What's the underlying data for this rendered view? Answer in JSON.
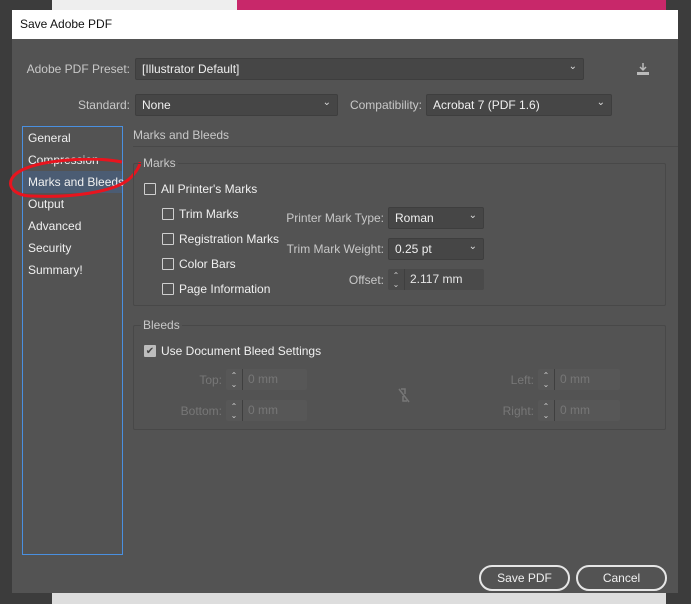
{
  "window": {
    "title": "Save Adobe PDF"
  },
  "preset": {
    "label": "Adobe PDF Preset:",
    "value": "[Illustrator Default]"
  },
  "standard": {
    "label": "Standard:",
    "value": "None"
  },
  "compatibility": {
    "label": "Compatibility:",
    "value": "Acrobat 7 (PDF 1.6)"
  },
  "sidebar": {
    "items": [
      {
        "label": "General"
      },
      {
        "label": "Compression"
      },
      {
        "label": "Marks and Bleeds",
        "active": true
      },
      {
        "label": "Output"
      },
      {
        "label": "Advanced"
      },
      {
        "label": "Security"
      },
      {
        "label": "Summary!"
      }
    ]
  },
  "section_title": "Marks and Bleeds",
  "marks": {
    "title": "Marks",
    "all": {
      "label": "All Printer's Marks",
      "checked": false
    },
    "items": [
      {
        "label": "Trim Marks",
        "checked": false
      },
      {
        "label": "Registration Marks",
        "checked": false
      },
      {
        "label": "Color Bars",
        "checked": false
      },
      {
        "label": "Page Information",
        "checked": false
      }
    ],
    "type": {
      "label": "Printer Mark Type:",
      "value": "Roman"
    },
    "weight": {
      "label": "Trim Mark Weight:",
      "value": "0.25 pt"
    },
    "offset": {
      "label": "Offset:",
      "value": "2.117 mm"
    }
  },
  "bleeds": {
    "title": "Bleeds",
    "use_doc": {
      "label": "Use Document Bleed Settings",
      "checked": true
    },
    "top": {
      "label": "Top:",
      "value": "0 mm"
    },
    "bottom": {
      "label": "Bottom:",
      "value": "0 mm"
    },
    "left": {
      "label": "Left:",
      "value": "0 mm"
    },
    "right": {
      "label": "Right:",
      "value": "0 mm"
    }
  },
  "buttons": {
    "save": "Save PDF",
    "cancel": "Cancel"
  },
  "annotation": {
    "color": "#e8141e"
  }
}
